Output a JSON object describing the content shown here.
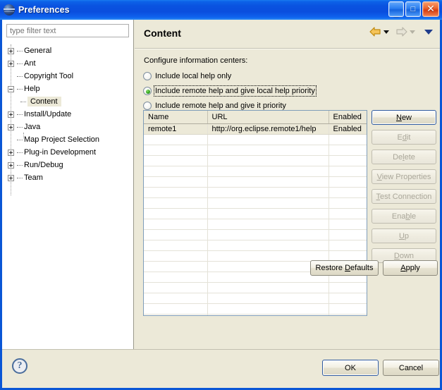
{
  "window": {
    "title": "Preferences",
    "icon": "globe-icon",
    "controls": {
      "minimize": "_",
      "maximize": "□",
      "close": "✕"
    }
  },
  "sidebar": {
    "filter": {
      "placeholder": "type filter text",
      "value": ""
    },
    "items": [
      {
        "label": "General",
        "expander": "plus",
        "level": 0
      },
      {
        "label": "Ant",
        "expander": "plus",
        "level": 0
      },
      {
        "label": "Copyright Tool",
        "expander": "none",
        "level": 0
      },
      {
        "label": "Help",
        "expander": "minus",
        "level": 0
      },
      {
        "label": "Content",
        "expander": "none",
        "level": 1,
        "selected": true
      },
      {
        "label": "Install/Update",
        "expander": "plus",
        "level": 0
      },
      {
        "label": "Java",
        "expander": "plus",
        "level": 0
      },
      {
        "label": "Map Project Selection",
        "expander": "none",
        "level": 0
      },
      {
        "label": "Plug-in Development",
        "expander": "plus",
        "level": 0
      },
      {
        "label": "Run/Debug",
        "expander": "plus",
        "level": 0
      },
      {
        "label": "Team",
        "expander": "plus",
        "level": 0
      }
    ]
  },
  "content": {
    "title": "Content",
    "nav": {
      "back_icon": "back-arrow-icon",
      "back_dropdown_icon": "chevron-down-icon",
      "forward_icon": "forward-arrow-icon",
      "forward_dropdown_icon": "chevron-down-icon",
      "menu_icon": "view-menu-chevron-icon"
    },
    "group_label": "Configure information centers:",
    "radios": [
      {
        "label": "Include local help only",
        "selected": false,
        "focused": false
      },
      {
        "label": "Include remote help and give local help priority",
        "selected": true,
        "focused": true
      },
      {
        "label": "Include remote help and give it priority",
        "selected": false,
        "focused": false
      }
    ],
    "table": {
      "columns": [
        "Name",
        "URL",
        "Enabled"
      ],
      "rows": [
        {
          "name": "remote1",
          "url": "http://org.eclipse.remote1/help",
          "enabled": "Enabled",
          "selected": true
        }
      ],
      "empty_row_count": 19
    },
    "side_buttons": [
      {
        "label": "New",
        "mnemonic": "N",
        "enabled": true,
        "default": true
      },
      {
        "label": "Edit",
        "mnemonic": "d",
        "enabled": false,
        "default": false
      },
      {
        "label": "Delete",
        "mnemonic": "l",
        "enabled": false,
        "default": false
      },
      {
        "label": "View Properties",
        "mnemonic": "V",
        "enabled": false,
        "default": false
      },
      {
        "label": "Test Connection",
        "mnemonic": "T",
        "enabled": false,
        "default": false
      },
      {
        "label": "Enable",
        "mnemonic": "b",
        "enabled": false,
        "default": false
      },
      {
        "label": "Up",
        "mnemonic": "U",
        "enabled": false,
        "default": false
      },
      {
        "label": "Down",
        "mnemonic": "D",
        "enabled": false,
        "default": false
      }
    ],
    "restore_defaults": {
      "label": "Restore Defaults",
      "mnemonic": "D"
    },
    "apply": {
      "label": "Apply",
      "mnemonic": "A"
    }
  },
  "footer": {
    "help_icon": "question-mark-icon",
    "help_glyph": "?",
    "ok": "OK",
    "cancel": "Cancel"
  },
  "colors": {
    "titlebar_blue": "#0a53e0",
    "dialog_bg": "#ece9d8",
    "table_border": "#7f9db9",
    "radio_dot_green": "#2aa018",
    "back_arrow_gold": "#e8a317",
    "forward_arrow_gray": "#c9c6b8",
    "menu_chevron_navy": "#1f3c8b"
  }
}
